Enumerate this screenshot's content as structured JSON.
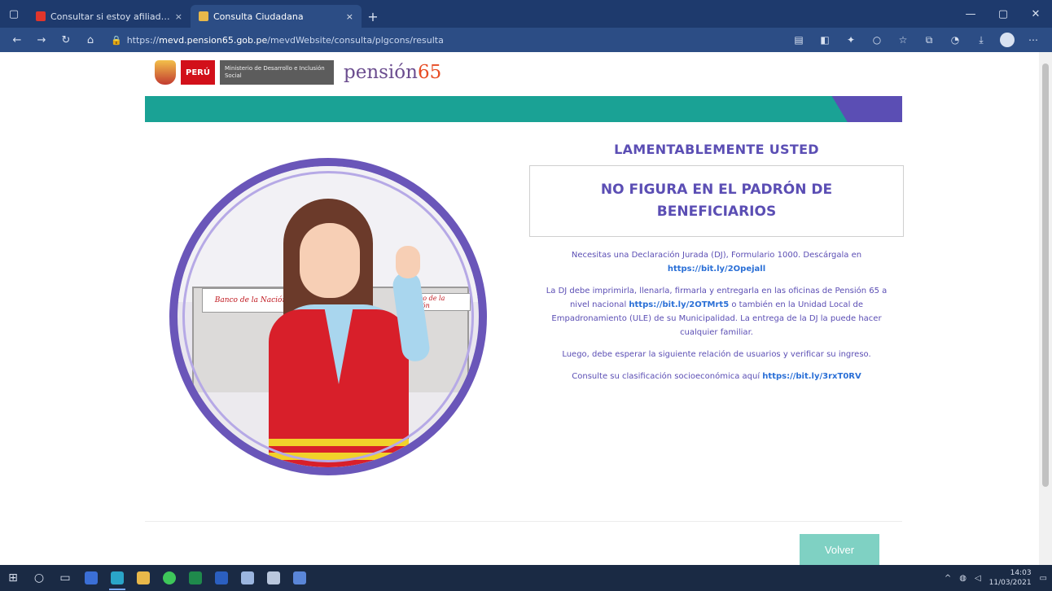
{
  "browser": {
    "tabs": [
      {
        "title": "Consultar si estoy afiliado al Pe",
        "favicon_color": "#e0352b",
        "active": false
      },
      {
        "title": "Consulta Ciudadana",
        "favicon_color": "#e8b84a",
        "active": true
      }
    ],
    "close_glyph": "×",
    "newtab_glyph": "+",
    "url_prefix": "https://",
    "url_host": "mevd.pension65.gob.pe",
    "url_path": "/mevdWebsite/consulta/plgcons/resulta"
  },
  "header": {
    "brand": "pensión",
    "brand_number": "65",
    "peru_label": "PERÚ",
    "ministry_label": "Ministerio de Desarrollo e Inclusión Social"
  },
  "illustration": {
    "sign_text": "Banco de la Nación",
    "sign_text_2": "Banco de la Nación"
  },
  "result": {
    "title": "LAMENTABLEMENTE USTED",
    "box_text": "NO FIGURA EN EL PADRÓN DE BENEFICIARIOS",
    "p1_text": "Necesitas una Declaración Jurada (DJ), Formulario 1000. Descárgala en ",
    "p1_link": "https://bit.ly/2Opejall",
    "p2_text_a": "La DJ debe imprimirla, llenarla, firmarla y entregarla en las oficinas de Pensión 65 a nivel nacional ",
    "p2_link": "https://bit.ly/2OTMrt5",
    "p2_text_b": " o también en la Unidad Local de Empadronamiento (ULE) de su Municipalidad. La entrega de la DJ la puede hacer cualquier familiar.",
    "p3_text": "Luego, debe esperar la siguiente relación de usuarios y verificar su ingreso.",
    "p4_text": "Consulte su clasificación socioeconómica aquí ",
    "p4_link": "https://bit.ly/3rxT0RV"
  },
  "actions": {
    "back_label": "Volver"
  },
  "taskbar": {
    "time": "14:03",
    "date": "11/03/2021"
  }
}
